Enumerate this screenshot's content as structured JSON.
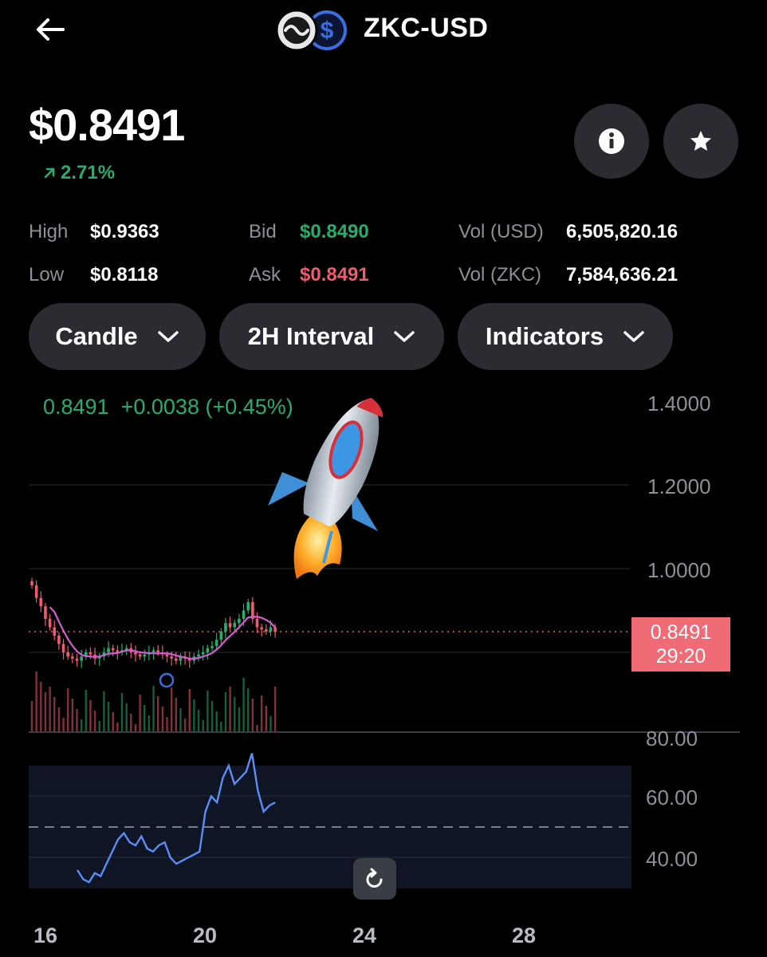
{
  "header": {
    "title": "ZKC-USD",
    "back_icon": "arrow-left-icon",
    "logo_icons": [
      "zkc-logo-icon",
      "usd-coin-icon"
    ]
  },
  "price": {
    "current": "$0.8491",
    "change": "2.71%",
    "change_icon": "arrow-up-right-icon",
    "change_color": "#27ae6e"
  },
  "actions": {
    "info_icon": "info-icon",
    "star_icon": "star-icon"
  },
  "stats": {
    "high_label": "High",
    "high_value": "$0.9363",
    "low_label": "Low",
    "low_value": "$0.8118",
    "bid_label": "Bid",
    "bid_value": "$0.8490",
    "ask_label": "Ask",
    "ask_value": "$0.8491",
    "vol_usd_label": "Vol (USD)",
    "vol_usd_value": "6,505,820.16",
    "vol_zkc_label": "Vol (ZKC)",
    "vol_zkc_value": "7,584,636.21"
  },
  "controls": {
    "chart_type": "Candle",
    "interval": "2H Interval",
    "indicators": "Indicators"
  },
  "chart": {
    "ohlc_price": "0.8491",
    "ohlc_change": "+0.0038 (+0.45%)",
    "price_axis": [
      "1.4000",
      "1.2000",
      "1.0000"
    ],
    "last_price_tag": "0.8491",
    "countdown": "29:20",
    "rsi_axis": [
      "80.00",
      "60.00",
      "40.00"
    ],
    "date_axis": [
      "16",
      "20",
      "24",
      "28"
    ],
    "sticker": "rocket-emoji",
    "up_color": "#27ae6e",
    "down_color": "#ef5a6f",
    "ma_color": "#d35bd1",
    "rsi_color": "#5b8ef5"
  }
}
